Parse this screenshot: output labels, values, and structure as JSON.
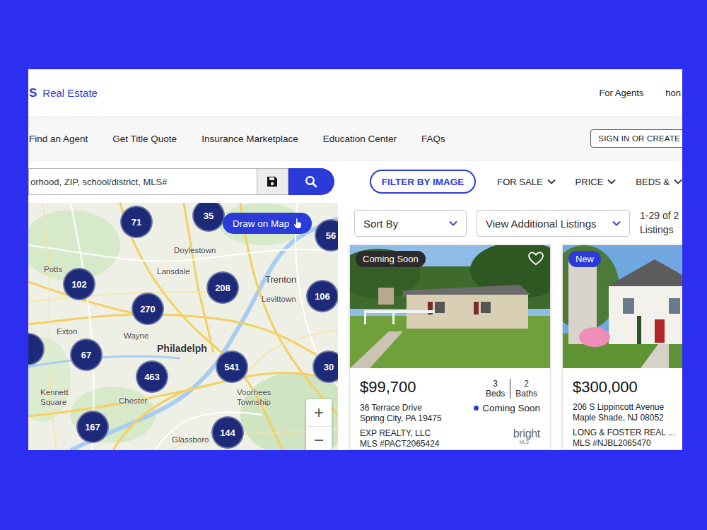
{
  "header": {
    "logo_mark": "S",
    "logo_text": "Real Estate",
    "links": [
      "For Agents",
      "hon"
    ]
  },
  "nav": {
    "items": [
      "Find an Agent",
      "Get Title Quote",
      "Insurance Marketplace",
      "Education Center",
      "FAQs"
    ],
    "sign_in": "SIGN IN OR CREATE"
  },
  "search": {
    "placeholder": "orhood, ZIP, school/district, MLS#"
  },
  "filters": {
    "image_button": "FILTER BY IMAGE",
    "dropdowns": [
      "FOR SALE",
      "PRICE",
      "BEDS &"
    ]
  },
  "map": {
    "draw_button": "Draw on Map",
    "clusters": [
      "71",
      "35",
      "56",
      "102",
      "208",
      "270",
      "106",
      "67",
      "541",
      "463",
      "30",
      "167",
      "144"
    ],
    "labels": [
      "Potts",
      "Doylestown",
      "Lansdale",
      "Trenton",
      "Levittown",
      "Exton",
      "Wayne",
      "Philadelph",
      "Kennett",
      "Square",
      "Chester",
      "Voorhees",
      "Township",
      "Glassboro"
    ],
    "zoom": [
      "+",
      "−"
    ]
  },
  "listings": {
    "sort": "Sort By",
    "additional": "View Additional Listings",
    "count": [
      "1-29 of 2",
      "Listings"
    ],
    "cards": [
      {
        "badge": {
          "text": "Coming Soon",
          "color": "#2b2b2b"
        },
        "favorited": false,
        "price": "$99,700",
        "beds": "3",
        "beds_label": "Beds",
        "baths": "2",
        "baths_label": "Baths",
        "address": "36 Terrace Drive",
        "city": "Spring City, PA 19475",
        "status": {
          "text": "Coming Soon",
          "color": "#2b3bd8"
        },
        "broker": "EXP REALTY, LLC",
        "mls": "MLS #PACT2065424",
        "source": {
          "name": "bright",
          "sub": "MLS"
        }
      },
      {
        "badge": {
          "text": "New",
          "color": "#2b3bd8"
        },
        "price": "$300,000",
        "address": "206 S Lippincott Avenue",
        "city": "Maple Shade, NJ 08052",
        "broker": "LONG & FOSTER REAL ...",
        "mls": "MLS #NJBL2065470"
      }
    ]
  }
}
